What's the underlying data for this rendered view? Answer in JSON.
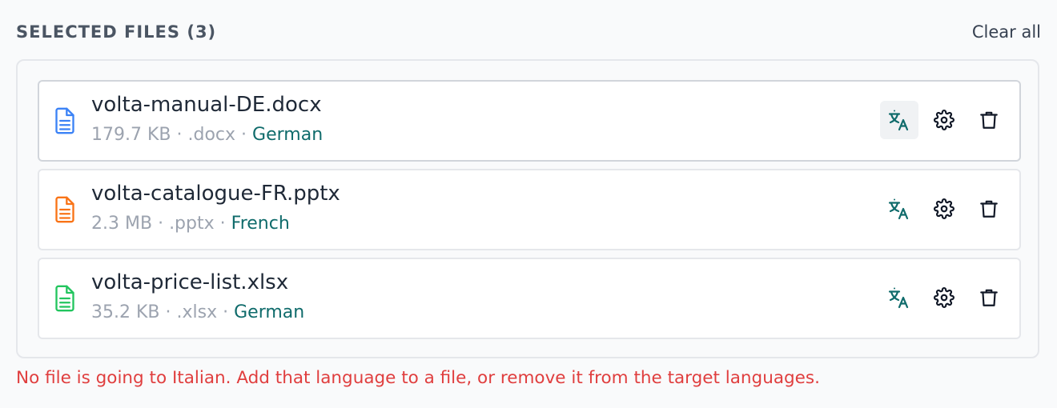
{
  "header": {
    "title": "SELECTED FILES (3)",
    "clear_label": "Clear all"
  },
  "files": [
    {
      "name": "volta-manual-DE.docx",
      "size": "179.7 KB",
      "ext": ".docx",
      "language": "German",
      "icon": "document-icon",
      "icon_color": "#3b82f6"
    },
    {
      "name": "volta-catalogue-FR.pptx",
      "size": "2.3 MB",
      "ext": ".pptx",
      "language": "French",
      "icon": "document-icon",
      "icon_color": "#f97316"
    },
    {
      "name": "volta-price-list.xlsx",
      "size": "35.2 KB",
      "ext": ".xlsx",
      "language": "German",
      "icon": "document-icon",
      "icon_color": "#22c55e"
    }
  ],
  "meta_separator": "·",
  "actions": [
    "translate-icon",
    "gear-icon",
    "trash-icon"
  ],
  "colors": {
    "language": "#0f6b6b",
    "error": "#e03e3e",
    "muted": "#9ca3af"
  },
  "error_message": "No file is going to Italian. Add that language to a file, or remove it from the target languages."
}
